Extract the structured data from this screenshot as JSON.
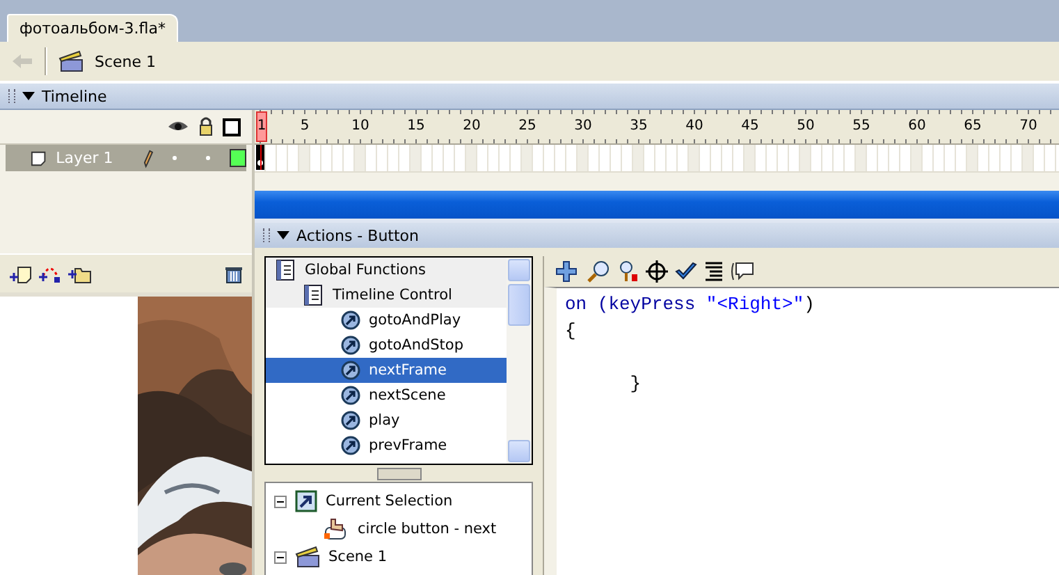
{
  "document_tab": {
    "title": "фотоальбом-3.fla*",
    "selected": true
  },
  "edit_bar": {
    "back_disabled": true,
    "scene": "Scene 1"
  },
  "timeline": {
    "title": "Timeline",
    "expanded": true,
    "current_frame": "1",
    "ruler_labels": [
      "5",
      "10",
      "15",
      "20",
      "25",
      "30",
      "35",
      "40",
      "45",
      "50",
      "55",
      "60",
      "65",
      "70"
    ],
    "layers": [
      {
        "name": "Layer 1",
        "selected": true,
        "editable": true,
        "keyframe": true,
        "color": "#55ff55"
      }
    ]
  },
  "actions_panel": {
    "title": "Actions - Button",
    "expanded": true,
    "toolbox": [
      {
        "label": "Global Functions",
        "kind": "book",
        "selected": false,
        "children": [
          {
            "label": "Timeline Control",
            "kind": "book",
            "selected": false,
            "children": [
              {
                "label": "gotoAndPlay",
                "kind": "action",
                "selected": false
              },
              {
                "label": "gotoAndStop",
                "kind": "action",
                "selected": false
              },
              {
                "label": "nextFrame",
                "kind": "action",
                "selected": true
              },
              {
                "label": "nextScene",
                "kind": "action",
                "selected": false
              },
              {
                "label": "play",
                "kind": "action",
                "selected": false
              },
              {
                "label": "prevFrame",
                "kind": "action",
                "selected": false
              }
            ]
          }
        ]
      }
    ],
    "script_navigator": [
      {
        "label": "Current Selection",
        "kind": "selection",
        "expanded": true,
        "children": [
          {
            "label": "circle button - next",
            "kind": "button"
          }
        ]
      },
      {
        "label": "Scene 1",
        "kind": "scene",
        "expanded": true
      }
    ],
    "code_lines": [
      {
        "tokens": [
          {
            "text": "on (keyPress ",
            "kind": "keyword"
          },
          {
            "text": "\"<Right>\"",
            "kind": "string"
          },
          {
            "text": ")",
            "kind": "plain"
          }
        ]
      },
      {
        "tokens": [
          {
            "text": "{",
            "kind": "plain"
          }
        ]
      },
      {
        "tokens": [
          {
            "text": "      }",
            "kind": "plain"
          }
        ],
        "blank_before": true
      }
    ]
  }
}
